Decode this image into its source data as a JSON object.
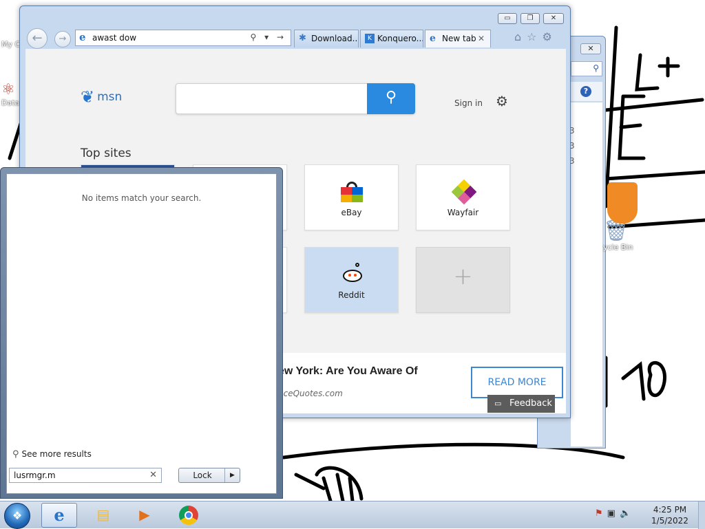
{
  "desktop": {
    "icons": [
      {
        "label": "My C"
      },
      {
        "label": "Data"
      },
      {
        "label": "ycle Bin"
      }
    ]
  },
  "background_window": {
    "close_label": "✕",
    "help_label": "?",
    "numbers": [
      "3",
      "3",
      "3"
    ]
  },
  "ie": {
    "window_controls": {
      "minimize": "▭",
      "restore": "❐",
      "close": "✕"
    },
    "address": "awast dow",
    "address_icons": "⚲ ▾ →",
    "tabs": [
      {
        "label": "Download..."
      },
      {
        "label": "Konquero..."
      },
      {
        "label": "New tab",
        "close": "✕"
      }
    ],
    "command_icons": {
      "home": "⌂",
      "favorites": "☆",
      "tools": "⚙"
    }
  },
  "msn": {
    "logo_text": "msn",
    "sign_in": "Sign in",
    "top_sites_heading": "Top sites",
    "tiles": [
      {
        "label": "eBay"
      },
      {
        "label": "Wayfair"
      },
      {
        "label": "Reddit"
      },
      {
        "label": ""
      }
    ],
    "add_tile_symbol": "+",
    "news": {
      "headline": "ew York: Are You Aware Of",
      "source": "nceQuotes.com",
      "read_more": "READ MORE"
    },
    "feedback": "Feedback"
  },
  "start_menu": {
    "no_items": "No items match your search.",
    "see_more": "See more results",
    "search_value": "lusrmgr.m",
    "lock_label": "Lock",
    "lock_arrow": "▶"
  },
  "taskbar": {
    "time": "4:25 PM",
    "date": "1/5/2022"
  }
}
